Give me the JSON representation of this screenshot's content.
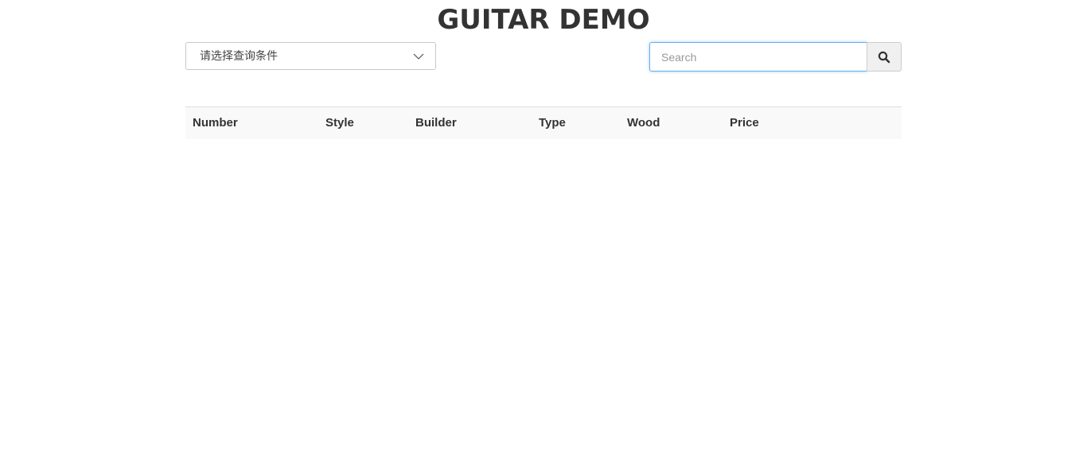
{
  "header": {
    "title": "GUITAR DEMO"
  },
  "filter": {
    "select_placeholder": "请选择查询条件",
    "chevron_icon": "chevron-down-icon"
  },
  "search": {
    "placeholder": "Search",
    "value": "",
    "button_icon": "search-icon",
    "focus_color": "#66afe9"
  },
  "table": {
    "columns": [
      {
        "label": "Number"
      },
      {
        "label": "Style"
      },
      {
        "label": "Builder"
      },
      {
        "label": "Type"
      },
      {
        "label": "Wood"
      },
      {
        "label": "Price"
      }
    ],
    "rows": []
  }
}
